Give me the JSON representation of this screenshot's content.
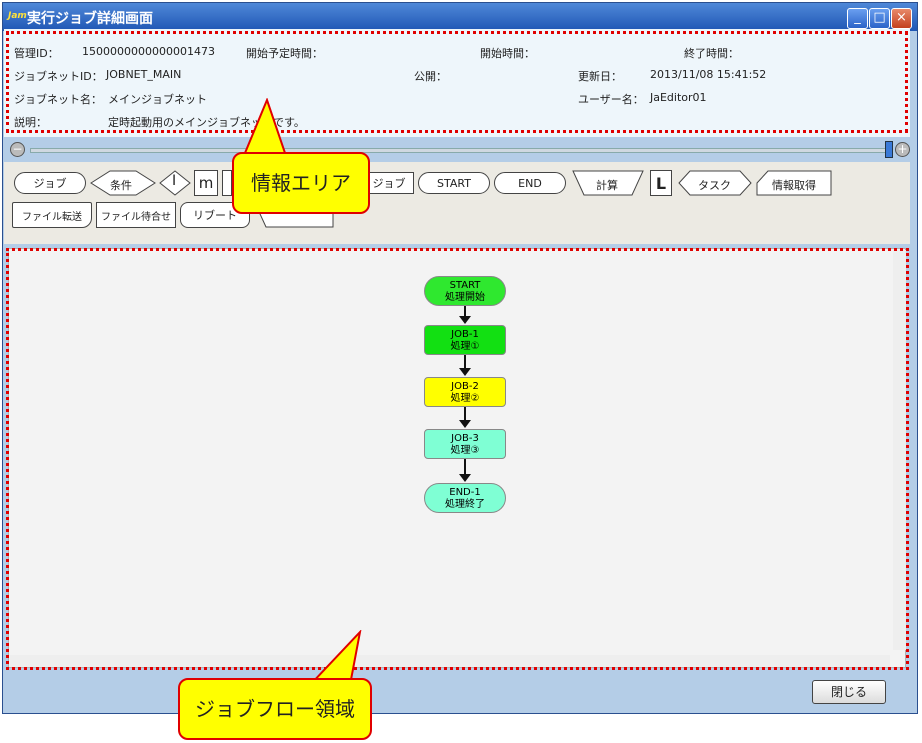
{
  "window": {
    "app_icon": "Jam",
    "title": "実行ジョブ詳細画面",
    "buttons": [
      "_",
      "□",
      "×"
    ]
  },
  "info": {
    "manage_id_label": "管理ID：",
    "manage_id_value": "1500000000000001473",
    "scheduled_start_label": "開始予定時間：",
    "start_time_label": "開始時間：",
    "end_time_label": "終了時間：",
    "jobnet_id_label": "ジョブネットID：",
    "jobnet_id_value": "JOBNET_MAIN",
    "public_label": "公開：",
    "updated_label": "更新日：",
    "updated_value": "2013/11/08 15:41:52",
    "jobnet_name_label": "ジョブネット名：",
    "jobnet_name_value": "メインジョブネット",
    "user_label": "ユーザー名：",
    "user_value": "JaEditor01",
    "desc_label": "説明：",
    "desc_value": "定時起動用のメインジョブネットです。"
  },
  "palette": {
    "row1": [
      "ジョブ",
      "条件",
      "I",
      "m",
      "ジョブ",
      "START",
      "END",
      "計算",
      "L",
      "タスク",
      "情報取得"
    ],
    "row2": [
      "ファイル転送",
      "ファイル待合せ",
      "リブート"
    ]
  },
  "flow": {
    "nodes": [
      {
        "id": "START",
        "label": "処理開始",
        "color": "#2fe82f"
      },
      {
        "id": "JOB-1",
        "label": "処理①",
        "color": "#12e012"
      },
      {
        "id": "JOB-2",
        "label": "処理②",
        "color": "#ffff00"
      },
      {
        "id": "JOB-3",
        "label": "処理③",
        "color": "#7fffd4"
      },
      {
        "id": "END-1",
        "label": "処理終了",
        "color": "#7fffd4"
      }
    ]
  },
  "footer": {
    "close_label": "閉じる"
  },
  "callouts": {
    "info_area": "情報エリア",
    "flow_area": "ジョブフロー領域"
  }
}
